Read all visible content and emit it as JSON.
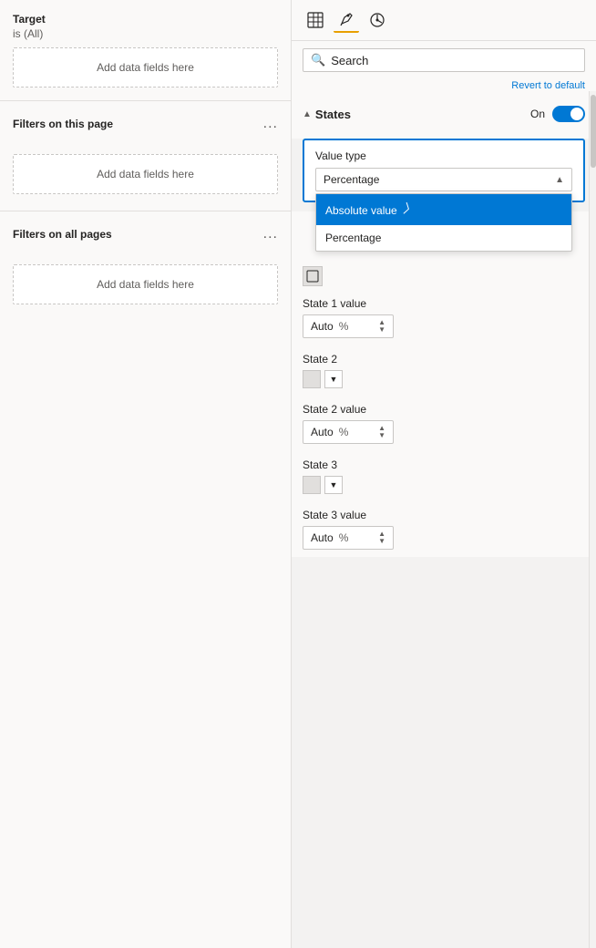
{
  "left_panel": {
    "target_label": "Target",
    "target_value": "is (All)",
    "add_fields_label": "Add data fields here",
    "filters_on_page_label": "Filters on this page",
    "filters_on_page_dots": "...",
    "filters_all_pages_label": "Filters on all pages",
    "filters_all_pages_dots": "..."
  },
  "right_panel": {
    "toolbar": {
      "icon1": "table-icon",
      "icon2": "paint-icon",
      "icon3": "analytics-icon"
    },
    "search": {
      "placeholder": "Search",
      "value": "Search"
    },
    "revert_link": "Revert to default",
    "states": {
      "label": "States",
      "toggle_label": "On",
      "is_on": true
    },
    "value_type": {
      "label": "Value type",
      "current_value": "Percentage",
      "options": [
        {
          "label": "Absolute value",
          "selected": false,
          "highlighted": true
        },
        {
          "label": "Percentage",
          "selected": false
        }
      ]
    },
    "state1_value": {
      "label": "State 1 value",
      "value": "Auto",
      "unit": "%"
    },
    "state2": {
      "label": "State 2"
    },
    "state2_value": {
      "label": "State 2 value",
      "value": "Auto",
      "unit": "%"
    },
    "state3": {
      "label": "State 3"
    },
    "state3_value": {
      "label": "State 3 value",
      "value": "Auto",
      "unit": "%"
    }
  }
}
